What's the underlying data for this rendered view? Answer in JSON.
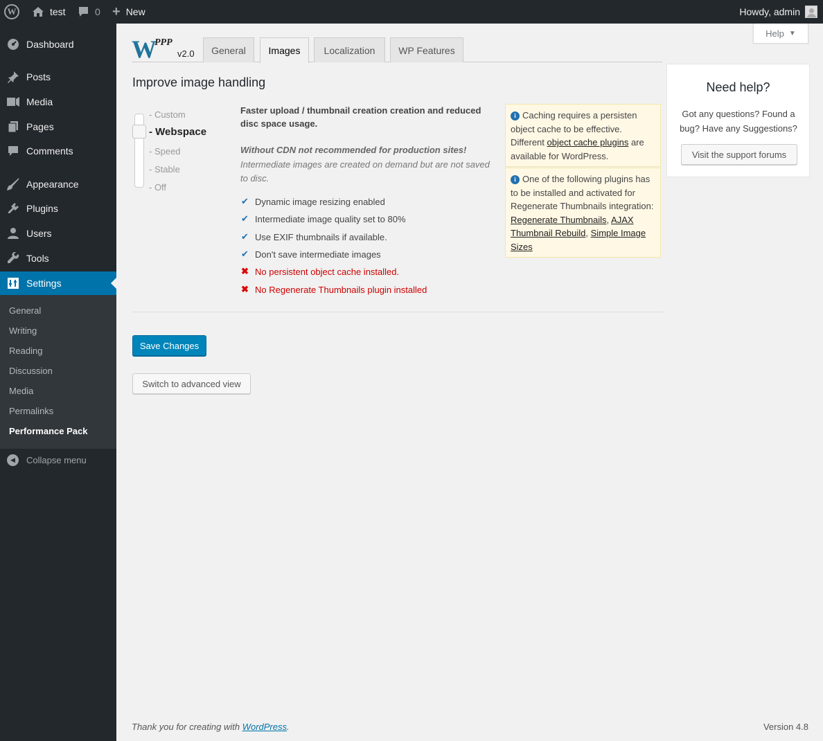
{
  "admin_bar": {
    "site_name": "test",
    "comments_count": "0",
    "new_label": "New",
    "howdy": "Howdy, admin"
  },
  "sidebar": {
    "items": [
      {
        "label": "Dashboard",
        "icon": "dashboard-icon"
      },
      {
        "label": "Posts",
        "icon": "pin-icon"
      },
      {
        "label": "Media",
        "icon": "media-icon"
      },
      {
        "label": "Pages",
        "icon": "pages-icon"
      },
      {
        "label": "Comments",
        "icon": "comments-icon"
      },
      {
        "label": "Appearance",
        "icon": "brush-icon"
      },
      {
        "label": "Plugins",
        "icon": "plug-icon"
      },
      {
        "label": "Users",
        "icon": "users-icon"
      },
      {
        "label": "Tools",
        "icon": "wrench-icon"
      },
      {
        "label": "Settings",
        "icon": "settings-icon"
      }
    ],
    "submenu": [
      "General",
      "Writing",
      "Reading",
      "Discussion",
      "Media",
      "Permalinks",
      "Performance Pack"
    ],
    "collapse_label": "Collapse menu"
  },
  "help_tab": "Help",
  "logo": {
    "ppp": "PPP",
    "version": "v2.0"
  },
  "tabs": [
    "General",
    "Images",
    "Localization",
    "WP Features"
  ],
  "page": {
    "heading": "Improve image handling",
    "levels": [
      "- Custom",
      "- Webspace",
      "- Speed",
      "- Stable",
      "- Off"
    ],
    "description": "Faster upload / thumbnail creation creation and reduced disc space usage.",
    "warning_bold": "Without CDN not recommended for production sites!",
    "warning_text": "Intermediate images are created on demand but are not saved to disc.",
    "checks": [
      {
        "text": "Dynamic image resizing enabled",
        "ok": true
      },
      {
        "text": "Intermediate image quality set to 80%",
        "ok": true
      },
      {
        "text": "Use EXIF thumbnails if available.",
        "ok": true
      },
      {
        "text": "Don't save intermediate images",
        "ok": true
      },
      {
        "text": "No persistent object cache installed.",
        "ok": false
      },
      {
        "text": "No Regenerate Thumbnails plugin installed",
        "ok": false
      }
    ],
    "notice1": {
      "pre": "Caching requires a persisten object cache to be effective. Different ",
      "link": "object cache plugins",
      "post": " are available for WordPress."
    },
    "notice2": {
      "pre": "One of the following plugins has to be installed and activated for Regenerate Thumbnails integration: ",
      "link1": "Regenerate Thumbnails",
      "sep1": ", ",
      "link2": "AJAX Thumbnail Rebuild",
      "sep2": ", ",
      "link3": "Simple Image Sizes"
    },
    "save_button": "Save Changes",
    "advanced_button": "Switch to advanced view"
  },
  "help_box": {
    "title": "Need help?",
    "text": "Got any questions? Found a bug? Have any Suggestions?",
    "button": "Visit the support forums"
  },
  "footer": {
    "thanks_pre": "Thank you for creating with ",
    "thanks_link": "WordPress",
    "thanks_post": ".",
    "version": "Version 4.8"
  },
  "colors": {
    "accent": "#0073aa",
    "primary_button": "#0085ba",
    "admin_bg": "#23282d",
    "error": "#cc0000"
  }
}
